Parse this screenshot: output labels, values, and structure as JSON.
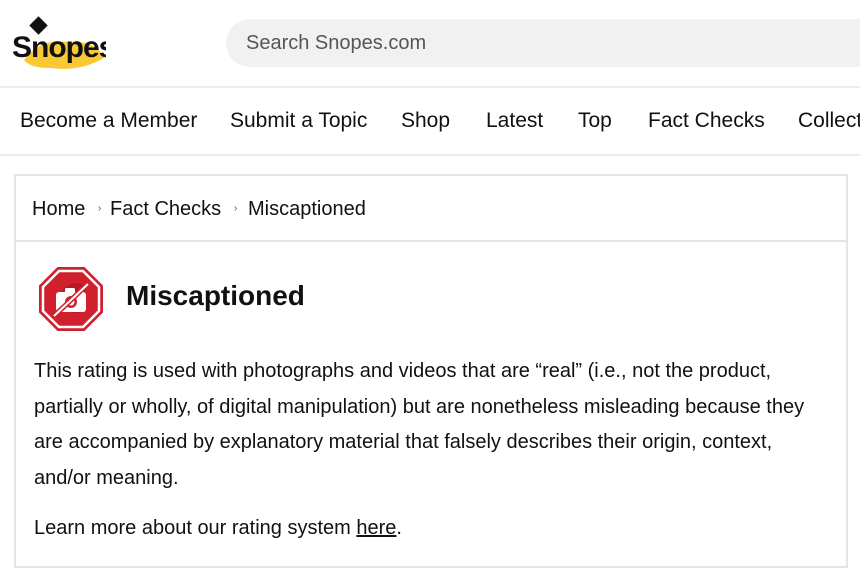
{
  "header": {
    "logo_text": "Snopes",
    "search_placeholder": "Search Snopes.com"
  },
  "nav": {
    "items": [
      "Become a Member",
      "Submit a Topic",
      "Shop",
      "Latest",
      "Top",
      "Fact Checks",
      "Collect"
    ]
  },
  "breadcrumb": {
    "items": [
      "Home",
      "Fact Checks",
      "Miscaptioned"
    ],
    "separator": "›"
  },
  "rating": {
    "icon": "no-camera-stop-icon",
    "title": "Miscaptioned",
    "description": "This rating is used with photographs and videos that are “real” (i.e., not the product, partially or wholly, of digital manipulation) but are nonetheless misleading because they are accompanied by explanatory material that falsely describes their origin, context, and/or meaning.",
    "learn_more_prefix": "Learn more about our rating system ",
    "learn_more_link": "here",
    "learn_more_suffix": "."
  },
  "colors": {
    "logo_yellow": "#f8c934",
    "rating_red": "#d0202e",
    "search_bg": "#f1f1f1",
    "border": "#e5e5e5"
  }
}
